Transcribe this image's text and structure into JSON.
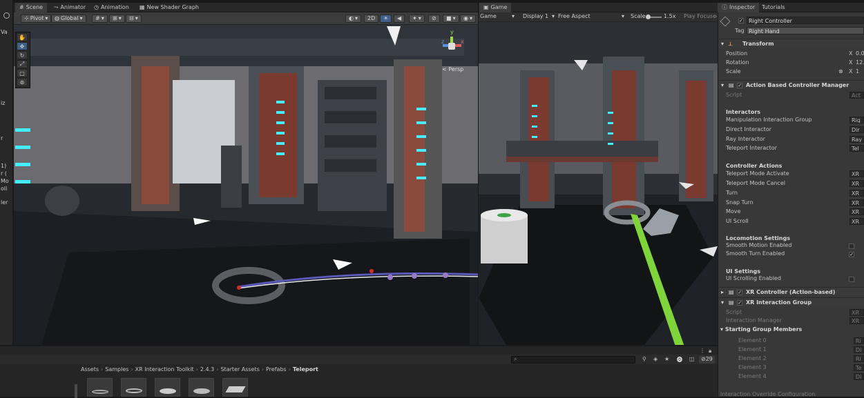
{
  "scene_tabs": [
    {
      "label": "Scene",
      "icon": "hash-icon"
    },
    {
      "label": "Animator",
      "icon": "animator-icon"
    },
    {
      "label": "Animation",
      "icon": "animation-icon"
    },
    {
      "label": "New Shader Graph",
      "icon": "shader-graph-icon"
    }
  ],
  "scene_toolbar": {
    "pivot": "Pivot",
    "global": "Global",
    "mode_2d": "2D",
    "persp_label": "< Persp",
    "gizmo_y": "y",
    "gizmo_x": "x",
    "gizmo_z": "z"
  },
  "game_tab": {
    "label": "Game"
  },
  "game_toolbar": {
    "display_mode": "Game",
    "display": "Display 1",
    "aspect": "Free Aspect",
    "scale_label": "Scale",
    "scale_value": "1.5x",
    "play_focused": "Play Focused"
  },
  "left_partial": [
    "Va",
    "iz",
    "r",
    "1)",
    "r (",
    "Mo",
    "oli",
    "ler"
  ],
  "inspector": {
    "tabs": [
      "Inspector",
      "Tutorials"
    ],
    "object_name": "Right Controller",
    "tag_label": "Tag",
    "tag_value": "Right Hand",
    "transform": {
      "title": "Transform",
      "rows": [
        {
          "label": "Position",
          "axis": "X",
          "value": "0.0"
        },
        {
          "label": "Rotation",
          "axis": "X",
          "value": "12."
        },
        {
          "label": "Scale",
          "axis": "X",
          "value": "1"
        }
      ]
    },
    "action_manager": {
      "title": "Action Based Controller Manager",
      "script_label": "Script",
      "script_value": "Act",
      "interactors_header": "Interactors",
      "interactors": [
        {
          "label": "Manipulation Interaction Group",
          "value": "Rig"
        },
        {
          "label": "Direct Interactor",
          "value": "Dir"
        },
        {
          "label": "Ray Interactor",
          "value": "Ray"
        },
        {
          "label": "Teleport Interactor",
          "value": "Tel"
        }
      ],
      "actions_header": "Controller Actions",
      "actions": [
        {
          "label": "Teleport Mode Activate",
          "value": "XR"
        },
        {
          "label": "Teleport Mode Cancel",
          "value": "XR"
        },
        {
          "label": "Turn",
          "value": "XR"
        },
        {
          "label": "Snap Turn",
          "value": "XR"
        },
        {
          "label": "Move",
          "value": "XR"
        },
        {
          "label": "UI Scroll",
          "value": "XR"
        }
      ],
      "locomotion_header": "Locomotion Settings",
      "smooth_motion": "Smooth Motion Enabled",
      "smooth_turn": "Smooth Turn Enabled",
      "ui_header": "UI Settings",
      "ui_scrolling": "UI Scrolling Enabled"
    },
    "xr_controller": {
      "title": "XR Controller (Action-based)"
    },
    "xr_group": {
      "title": "XR Interaction Group",
      "script_label": "Script",
      "script_value": "XR",
      "manager_label": "Interaction Manager",
      "manager_value": "XR",
      "members_header": "Starting Group Members",
      "elements": [
        {
          "label": "Element 0",
          "value": "Ri"
        },
        {
          "label": "Element 1",
          "value": "Di"
        },
        {
          "label": "Element 2",
          "value": "Ri"
        },
        {
          "label": "Element 3",
          "value": "Te"
        },
        {
          "label": "Element 4",
          "value": "Di"
        }
      ],
      "override_header": "Interaction Override Configuration"
    },
    "checkbox_mark": "✓"
  },
  "project": {
    "breadcrumb": [
      "Assets",
      "Samples",
      "XR Interaction Toolkit",
      "2.4.3",
      "Starter Assets",
      "Prefabs",
      "Teleport"
    ],
    "separator": "›",
    "badge_count": "29"
  }
}
